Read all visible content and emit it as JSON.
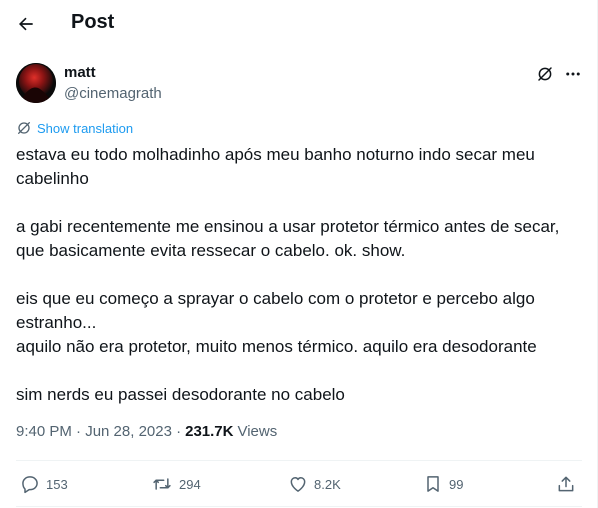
{
  "header": {
    "title": "Post"
  },
  "author": {
    "name": "matt",
    "handle": "@cinemagrath"
  },
  "post": {
    "translate_label": "Show translation",
    "lines": [
      "estava eu todo molhadinho após meu banho noturno indo secar meu",
      "cabelinho",
      "a gabi recentemente me ensinou a usar protetor térmico antes de secar,",
      "que basicamente evita ressecar o cabelo. ok. show.",
      "eis que eu começo a sprayar o cabelo com o protetor e percebo algo",
      "estranho...",
      "aquilo não era protetor, muito menos térmico. aquilo era desodorante",
      "sim nerds eu passei desodorante no cabelo"
    ],
    "timestamp": "9:40 PM · Jun 28, 2023 ·",
    "views_count": "231.7K",
    "views_label": "Views"
  },
  "actions": {
    "replies": "153",
    "reposts": "294",
    "likes": "8.2K",
    "bookmarks": "99"
  },
  "colors": {
    "accent": "#1d9bf0",
    "secondary": "#536471",
    "text": "#0f1419",
    "divider": "#eff3f4"
  }
}
